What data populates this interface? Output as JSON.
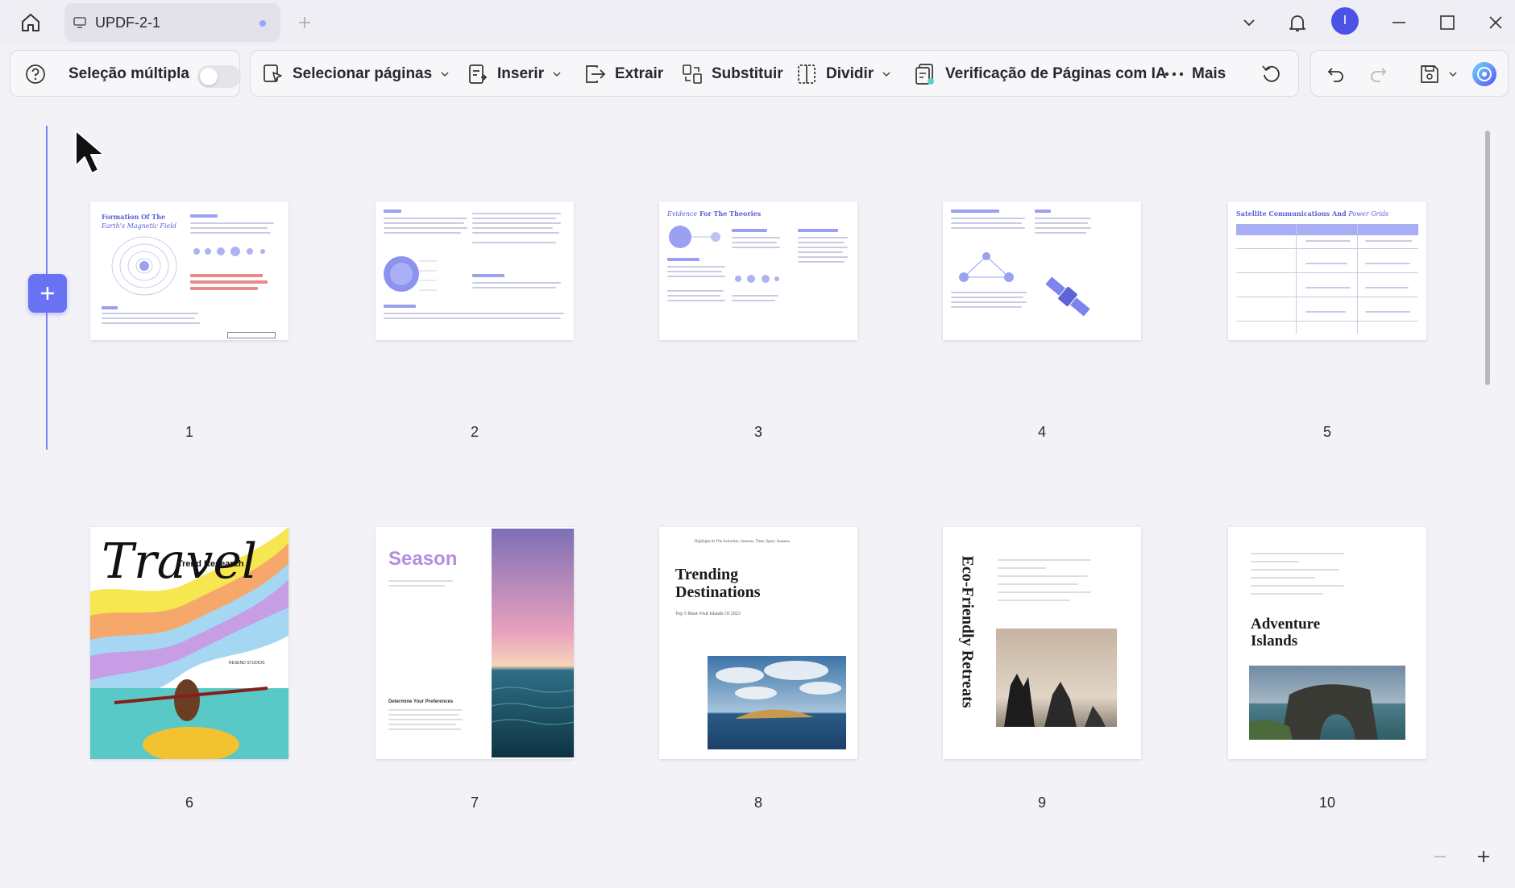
{
  "titlebar": {
    "tab_title": "UPDF-2-1",
    "avatar_letter": "I"
  },
  "toolbar": {
    "multi_select_label": "Seleção múltipla",
    "multi_select_on": false,
    "select_pages_label": "Selecionar páginas",
    "insert_label": "Inserir",
    "extract_label": "Extrair",
    "replace_label": "Substituir",
    "split_label": "Dividir",
    "ai_check_label": "Verificação de Páginas com IA",
    "more_label": "Mais"
  },
  "pages": [
    {
      "number": "1",
      "title": "Formation Of The",
      "title2": "Earth's Magnetic Field"
    },
    {
      "number": "2"
    },
    {
      "number": "3",
      "title": "For The Theories",
      "title_em": "Evidence"
    },
    {
      "number": "4"
    },
    {
      "number": "5",
      "title": "Satellite Communications And",
      "title_em": "Power Grids"
    },
    {
      "number": "6",
      "title": "Travel",
      "subtitle": "Trend Research",
      "byline": "RESEND STUDIOS"
    },
    {
      "number": "7",
      "title": "Season",
      "subtitle": "Determine Your Preferences"
    },
    {
      "number": "8",
      "title": "Trending Destinations",
      "subtitle": "Top 5 Must-Visit Islands Of 2023",
      "header": "Highlight At The Activities, Seasons, Time, Sport, Seasons"
    },
    {
      "number": "9",
      "title": "Eco-Friendly Retreats"
    },
    {
      "number": "10",
      "title": "Adventure Islands"
    }
  ],
  "colors": {
    "accent": "#6a72f4",
    "page_title_blue": "#5a5fd8",
    "avatar": "#4b52e6"
  }
}
